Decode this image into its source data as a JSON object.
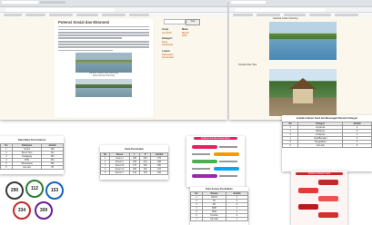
{
  "left_window": {
    "article": {
      "title": "Potensi Sosial dan Ekonomi",
      "caption": "Gambar Kolam Ikan Kampung\nDesa Sumber Pancing"
    },
    "sidebar": {
      "search_button": "Cari",
      "sections": [
        {
          "heading": "Arsip",
          "items": [
            "Juli 2019"
          ]
        },
        {
          "heading": "Kategori",
          "items": [
            "Desa",
            "Pariwisata"
          ]
        },
        {
          "heading": "Lokasi",
          "items": [
            "Kabupaten",
            "Kecamatan"
          ]
        },
        {
          "heading": "Meta",
          "items": [
            "Masuk",
            "RSS"
          ]
        }
      ]
    }
  },
  "right_window": {
    "photo_labels": [
      "Gambar Kolam Pancing",
      "Pondok Akar Tani"
    ]
  },
  "table_top_right": {
    "title": "Jumlah Industri Kecil dan Menengah Menurut Kategori",
    "headers": [
      "No",
      "Kategori",
      "Jumlah"
    ],
    "rows": [
      [
        "1",
        "Anyaman",
        "4"
      ],
      [
        "2",
        "Makanan",
        "8"
      ],
      [
        "3",
        "Kerajinan",
        "2"
      ],
      [
        "4",
        "Jasa/Bengkel",
        "5"
      ],
      [
        "5",
        "Pengolahan",
        "3"
      ],
      [
        "6",
        "Lain-lain",
        "6"
      ]
    ]
  },
  "table_left": {
    "title": "Data Mata Pencaharian",
    "headers": [
      "No",
      "Pekerjaan",
      "Jumlah"
    ],
    "rows": [
      [
        "1",
        "Petani",
        "290"
      ],
      [
        "2",
        "Buruh Tani",
        "112"
      ],
      [
        "3",
        "Pedagang",
        "153"
      ],
      [
        "4",
        "PNS",
        "334"
      ],
      [
        "5",
        "Wiraswasta",
        "309"
      ],
      [
        "6",
        "Lain-lain",
        "95"
      ]
    ]
  },
  "circles": [
    {
      "value": "290",
      "color": "#3a3a3a"
    },
    {
      "value": "112",
      "color": "#2e7d32"
    },
    {
      "value": "153",
      "color": "#1565c0"
    },
    {
      "value": "334",
      "color": "#c62828"
    },
    {
      "value": "309",
      "color": "#6a1b9a"
    }
  ],
  "table_center": {
    "title": "Data Penduduk",
    "headers": [
      "No",
      "Dusun",
      "L",
      "P",
      "Jumlah"
    ],
    "rows": [
      [
        "1",
        "Dusun I",
        "230",
        "245",
        "475"
      ],
      [
        "2",
        "Dusun II",
        "198",
        "210",
        "408"
      ],
      [
        "3",
        "Dusun III",
        "176",
        "184",
        "360"
      ],
      [
        "4",
        "Dusun IV",
        "150",
        "162",
        "312"
      ],
      [
        "5",
        "Dusun V",
        "143",
        "151",
        "294"
      ]
    ]
  },
  "infographic_pink": {
    "title": "Potensi Sumber Daya Alam",
    "colors": [
      "#e91e63",
      "#ff9800",
      "#4caf50",
      "#03a9f4",
      "#9c27b0"
    ]
  },
  "table_bottom_center": {
    "title": "Data Sarana Pendidikan",
    "headers": [
      "No",
      "Sarana",
      "Jumlah"
    ],
    "rows": [
      [
        "1",
        "PAUD",
        "2"
      ],
      [
        "2",
        "TK",
        "3"
      ],
      [
        "3",
        "SD",
        "4"
      ],
      [
        "4",
        "SMP",
        "1"
      ],
      [
        "5",
        "SMA",
        "1"
      ],
      [
        "6",
        "Pondok",
        "2"
      ],
      [
        "7",
        "Lain-lain",
        "1"
      ]
    ]
  },
  "infographic_red": {
    "title": "Potensi Industri Kecil",
    "colors": [
      "#c62828",
      "#e53935",
      "#ef5350",
      "#b71c1c",
      "#d32f2f"
    ]
  }
}
